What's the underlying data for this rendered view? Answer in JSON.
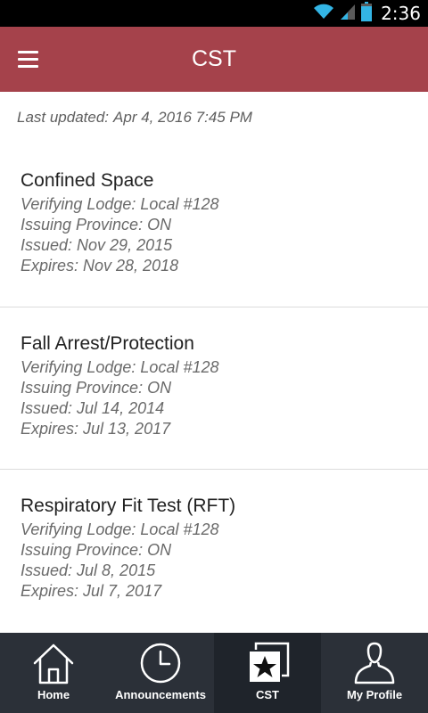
{
  "status_bar": {
    "time": "2:36",
    "icons": [
      "wifi-icon",
      "cell-signal-icon",
      "battery-icon"
    ]
  },
  "app_bar": {
    "title": "CST",
    "menu_icon": "hamburger-menu-icon",
    "background_color": "#a5424b"
  },
  "content": {
    "last_updated_label": "Last updated:",
    "last_updated_value": "Apr 4, 2016 7:45 PM",
    "certifications": [
      {
        "title": "Confined Space",
        "verifying_lodge": "Verifying Lodge: Local #128",
        "issuing_province": "Issuing Province: ON",
        "issued": "Issued: Nov 29, 2015",
        "expires": "Expires: Nov 28, 2018"
      },
      {
        "title": "Fall Arrest/Protection",
        "verifying_lodge": "Verifying Lodge: Local #128",
        "issuing_province": "Issuing Province: ON",
        "issued": "Issued: Jul 14, 2014",
        "expires": "Expires: Jul 13, 2017"
      },
      {
        "title": "Respiratory Fit Test (RFT)",
        "verifying_lodge": "Verifying Lodge: Local #128",
        "issuing_province": "Issuing Province: ON",
        "issued": "Issued: Jul 8, 2015",
        "expires": "Expires: Jul 7, 2017"
      }
    ]
  },
  "bottom_nav": {
    "items": [
      {
        "label": "Home",
        "icon": "home-icon",
        "active": false
      },
      {
        "label": "Announcements",
        "icon": "clock-icon",
        "active": false
      },
      {
        "label": "CST",
        "icon": "star-cards-icon",
        "active": true
      },
      {
        "label": "My Profile",
        "icon": "person-icon",
        "active": false
      }
    ]
  }
}
